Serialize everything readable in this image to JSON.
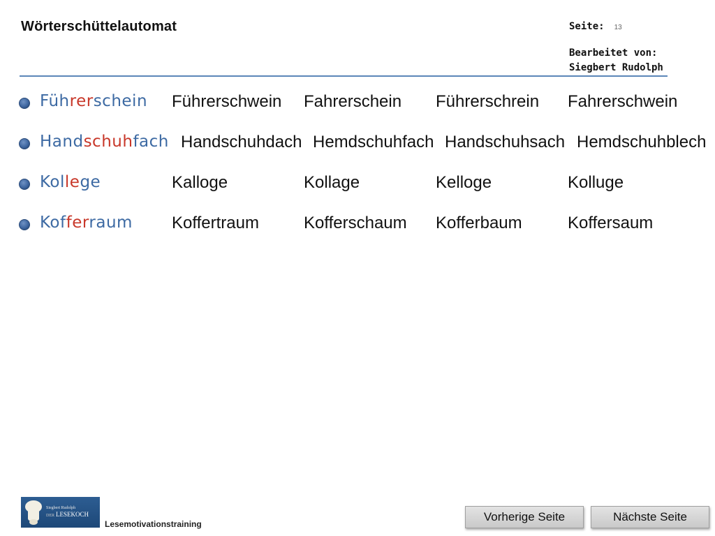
{
  "header": {
    "title": "Wörterschüttelautomat",
    "page_label": "Seite:",
    "page_number": "13",
    "edited_by_label": "Bearbeitet von:",
    "edited_by_name": "Siegbert Rudolph"
  },
  "colors": {
    "accent_blue": "#3d6aa3",
    "highlight_red": "#c8382a",
    "divider": "#5b86b8"
  },
  "rows": [
    {
      "target_segments": [
        {
          "text": "Füh",
          "color": "blue"
        },
        {
          "text": "rer",
          "color": "red"
        },
        {
          "text": "schein",
          "color": "blue"
        }
      ],
      "options": [
        "Führerschwein",
        "Fahrerschein",
        "Führerschrein",
        "Fahrerschwein"
      ]
    },
    {
      "target_segments": [
        {
          "text": "Hand",
          "color": "blue"
        },
        {
          "text": "schuh",
          "color": "red"
        },
        {
          "text": "fach",
          "color": "blue"
        }
      ],
      "options": [
        "Handschuhdach",
        "Hemdschuhfach",
        "Handschuhsach",
        "Hemdschuhblech"
      ]
    },
    {
      "target_segments": [
        {
          "text": "Kol",
          "color": "blue"
        },
        {
          "text": "le",
          "color": "red"
        },
        {
          "text": "ge",
          "color": "blue"
        }
      ],
      "options": [
        "Kalloge",
        "Kollage",
        "Kelloge",
        "Kolluge"
      ]
    },
    {
      "target_segments": [
        {
          "text": "Kof",
          "color": "blue"
        },
        {
          "text": "fer",
          "color": "red"
        },
        {
          "text": "raum",
          "color": "blue"
        }
      ],
      "options": [
        "Koffertraum",
        "Kofferschaum",
        "Kofferbaum",
        "Koffersaum"
      ]
    }
  ],
  "footer": {
    "logo_text_top": "Siegbert Rudolph",
    "logo_text_main": "LESEKOCH",
    "logo_text_prefix": "DER",
    "label": "Lesemotivationstraining",
    "prev_button": "Vorherige Seite",
    "next_button": "Nächste Seite"
  }
}
